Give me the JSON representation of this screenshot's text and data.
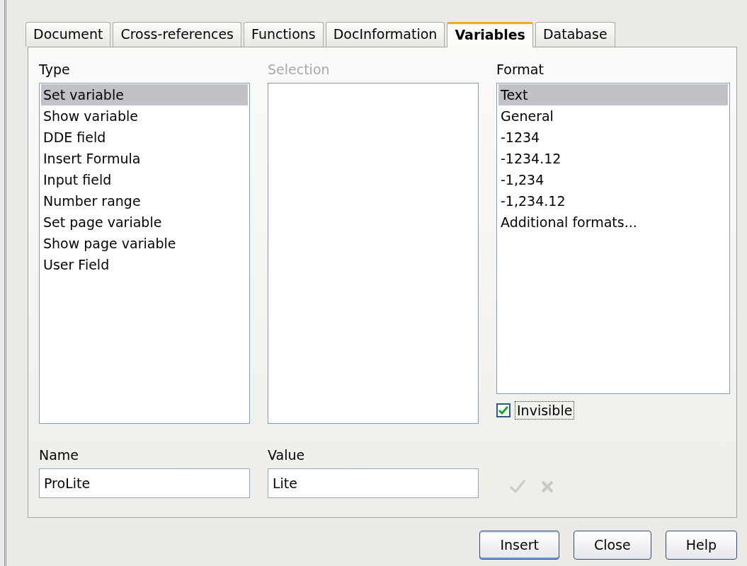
{
  "tabs": [
    {
      "label": "Document",
      "selected": false
    },
    {
      "label": "Cross-references",
      "selected": false
    },
    {
      "label": "Functions",
      "selected": false
    },
    {
      "label": "DocInformation",
      "selected": false
    },
    {
      "label": "Variables",
      "selected": true
    },
    {
      "label": "Database",
      "selected": false
    }
  ],
  "type_list": {
    "label": "Type",
    "items": [
      {
        "label": "Set variable",
        "selected": true
      },
      {
        "label": "Show variable",
        "selected": false
      },
      {
        "label": "DDE field",
        "selected": false
      },
      {
        "label": "Insert Formula",
        "selected": false
      },
      {
        "label": "Input field",
        "selected": false
      },
      {
        "label": "Number range",
        "selected": false
      },
      {
        "label": "Set page variable",
        "selected": false
      },
      {
        "label": "Show page variable",
        "selected": false
      },
      {
        "label": "User Field",
        "selected": false
      }
    ]
  },
  "selection_list": {
    "label": "Selection",
    "disabled": true
  },
  "format_list": {
    "label": "Format",
    "items": [
      {
        "label": "Text",
        "selected": true
      },
      {
        "label": "General",
        "selected": false
      },
      {
        "label": "-1234",
        "selected": false
      },
      {
        "label": "-1234.12",
        "selected": false
      },
      {
        "label": "-1,234",
        "selected": false
      },
      {
        "label": "-1,234.12",
        "selected": false
      },
      {
        "label": "Additional formats...",
        "selected": false
      }
    ]
  },
  "invisible": {
    "label": "Invisible",
    "checked": true
  },
  "name_field": {
    "label": "Name",
    "value": "ProLite"
  },
  "value_field": {
    "label": "Value",
    "value": "Lite",
    "disabled_actions": true
  },
  "buttons": [
    {
      "label": "Insert",
      "default": true
    },
    {
      "label": "Close",
      "default": false
    },
    {
      "label": "Help",
      "default": false
    }
  ]
}
